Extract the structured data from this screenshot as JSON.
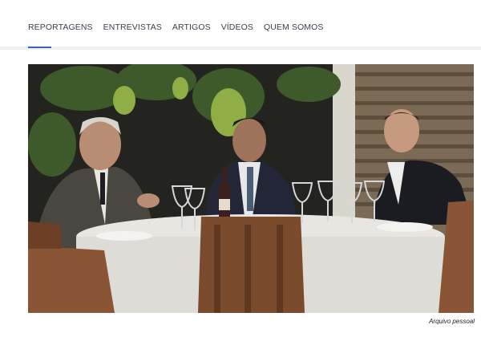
{
  "nav": {
    "items": [
      {
        "id": "reportagens",
        "label": "REPORTAGENS"
      },
      {
        "id": "entrevistas",
        "label": "ENTREVISTAS"
      },
      {
        "id": "artigos",
        "label": "ARTIGOS"
      },
      {
        "id": "videos",
        "label": "VÍDEOS"
      },
      {
        "id": "quem-somos",
        "label": "QUEM SOMOS"
      }
    ],
    "active": "reportagens"
  },
  "photo": {
    "caption": "Arquivo pessoal"
  },
  "colors": {
    "nav_text": "#3a3f4f",
    "accent": "#3a62b8",
    "divider": "#eef0f5"
  }
}
